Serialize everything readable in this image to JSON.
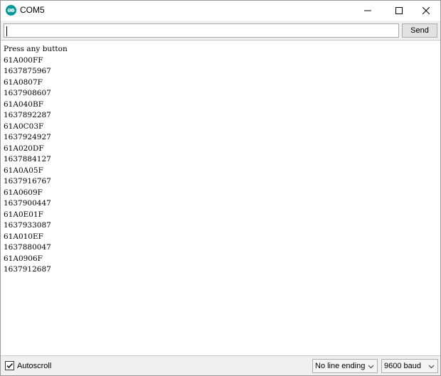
{
  "window": {
    "title": "COM5",
    "icon": "arduino-icon"
  },
  "titlebar_controls": {
    "minimize_icon": "minimize-icon",
    "maximize_icon": "maximize-icon",
    "close_icon": "close-icon"
  },
  "input": {
    "value": "",
    "send_label": "Send"
  },
  "output": {
    "lines": [
      "Press any button",
      "61A000FF",
      "1637875967",
      "61A0807F",
      "1637908607",
      "61A040BF",
      "1637892287",
      "61A0C03F",
      "1637924927",
      "61A020DF",
      "1637884127",
      "61A0A05F",
      "1637916767",
      "61A0609F",
      "1637900447",
      "61A0E01F",
      "1637933087",
      "61A010EF",
      "1637880047",
      "61A0906F",
      "1637912687"
    ]
  },
  "footer": {
    "autoscroll_label": "Autoscroll",
    "autoscroll_checked": true,
    "line_ending_value": "No line ending",
    "baud_value": "9600 baud"
  },
  "colors": {
    "accent_teal": "#00979c",
    "chrome_bg": "#f0f0f0"
  }
}
